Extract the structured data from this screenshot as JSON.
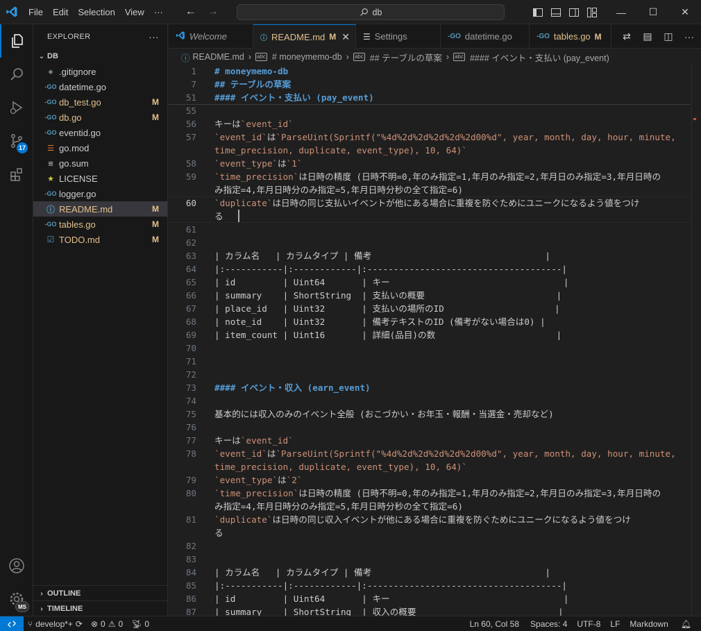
{
  "menu": {
    "file": "File",
    "edit": "Edit",
    "selection": "Selection",
    "view": "View",
    "more": "···"
  },
  "search": {
    "text": "db"
  },
  "activity": {
    "source_control_badge": "17",
    "accounts_badge": "MS"
  },
  "sidebar": {
    "title": "EXPLORER",
    "more": "···",
    "folder": "DB",
    "files": [
      {
        "name": ".gitignore",
        "icon": "gitignore-icon",
        "mod": ""
      },
      {
        "name": "datetime.go",
        "icon": "go-file-icon",
        "mod": ""
      },
      {
        "name": "db_test.go",
        "icon": "go-file-icon",
        "mod": "M"
      },
      {
        "name": "db.go",
        "icon": "go-file-icon",
        "mod": "M"
      },
      {
        "name": "eventid.go",
        "icon": "go-file-icon",
        "mod": ""
      },
      {
        "name": "go.mod",
        "icon": "go-mod-icon",
        "mod": ""
      },
      {
        "name": "go.sum",
        "icon": "go-sum-icon",
        "mod": ""
      },
      {
        "name": "LICENSE",
        "icon": "license-icon",
        "mod": ""
      },
      {
        "name": "logger.go",
        "icon": "go-file-icon",
        "mod": ""
      },
      {
        "name": "README.md",
        "icon": "info-icon",
        "mod": "M"
      },
      {
        "name": "tables.go",
        "icon": "go-file-icon",
        "mod": "M"
      },
      {
        "name": "TODO.md",
        "icon": "todo-icon",
        "mod": "M"
      }
    ],
    "outline": "OUTLINE",
    "timeline": "TIMELINE"
  },
  "tabs": [
    {
      "label": "Welcome",
      "mod": ""
    },
    {
      "label": "README.md",
      "mod": "M"
    },
    {
      "label": "Settings",
      "mod": ""
    },
    {
      "label": "datetime.go",
      "mod": ""
    },
    {
      "label": "tables.go",
      "mod": "M"
    }
  ],
  "breadcrumb": {
    "file": "README.md",
    "h1": "# moneymemo-db",
    "h2": "## テーブルの草案",
    "h4": "#### イベント・支払い (pay_event)"
  },
  "editor": {
    "sticky": [
      {
        "n": "1",
        "t": "# moneymemo-db"
      },
      {
        "n": "7",
        "t": "## テーブルの草案"
      },
      {
        "n": "51",
        "t": "#### イベント・支払い (pay_event)"
      }
    ],
    "lines": [
      {
        "n": "55",
        "t": ""
      },
      {
        "n": "56",
        "t": "キーは`event_id`"
      },
      {
        "n": "57",
        "t": "`event_id`は`ParseUint(Sprintf(\"%4d%2d%2d%2d%2d%2d00%d\", year, month, day, hour, minute,"
      },
      {
        "n": "",
        "t": "time_precision, duplicate, event_type), 10, 64)`"
      },
      {
        "n": "58",
        "t": "`event_type`は`1`"
      },
      {
        "n": "59",
        "t": "`time_precision`は日時の精度 (日時不明=0,年のみ指定=1,年月のみ指定=2,年月日のみ指定=3,年月日時の"
      },
      {
        "n": "",
        "t": "み指定=4,年月日時分のみ指定=5,年月日時分秒の全て指定=6)"
      },
      {
        "n": "60",
        "t": "`duplicate`は日時の同じ支払いイベントが他にある場合に重複を防ぐためにユニークになるよう値をつけ"
      },
      {
        "n": "",
        "t": "る"
      },
      {
        "n": "61",
        "t": ""
      },
      {
        "n": "62",
        "t": ""
      },
      {
        "n": "63",
        "t": "| カラム名   | カラムタイプ | 備考                                 |"
      },
      {
        "n": "64",
        "t": "|:-----------|:------------|:-------------------------------------|"
      },
      {
        "n": "65",
        "t": "| id         | Uint64       | キー                                 |"
      },
      {
        "n": "66",
        "t": "| summary    | ShortString  | 支払いの概要                         |"
      },
      {
        "n": "67",
        "t": "| place_id   | Uint32       | 支払いの場所のID                     |"
      },
      {
        "n": "68",
        "t": "| note_id    | Uint32       | 備考テキストのID (備考がない場合は0) |"
      },
      {
        "n": "69",
        "t": "| item_count | Uint16       | 詳細(品目)の数                       |"
      },
      {
        "n": "70",
        "t": ""
      },
      {
        "n": "71",
        "t": ""
      },
      {
        "n": "72",
        "t": ""
      },
      {
        "n": "73",
        "t": "#### イベント・収入 (earn_event)"
      },
      {
        "n": "74",
        "t": ""
      },
      {
        "n": "75",
        "t": "基本的には収入のみのイベント全般 (おこづかい・お年玉・報酬・当選金・売却など)"
      },
      {
        "n": "76",
        "t": ""
      },
      {
        "n": "77",
        "t": "キーは`event_id`"
      },
      {
        "n": "78",
        "t": "`event_id`は`ParseUint(Sprintf(\"%4d%2d%2d%2d%2d%2d00%d\", year, month, day, hour, minute,"
      },
      {
        "n": "",
        "t": "time_precision, duplicate, event_type), 10, 64)`"
      },
      {
        "n": "79",
        "t": "`event_type`は`2`"
      },
      {
        "n": "80",
        "t": "`time_precision`は日時の精度 (日時不明=0,年のみ指定=1,年月のみ指定=2,年月日のみ指定=3,年月日時の"
      },
      {
        "n": "",
        "t": "み指定=4,年月日時分のみ指定=5,年月日時分秒の全て指定=6)"
      },
      {
        "n": "81",
        "t": "`duplicate`は日時の同じ収入イベントが他にある場合に重複を防ぐためにユニークになるよう値をつけ"
      },
      {
        "n": "",
        "t": "る"
      },
      {
        "n": "82",
        "t": ""
      },
      {
        "n": "83",
        "t": ""
      },
      {
        "n": "84",
        "t": "| カラム名   | カラムタイプ | 備考                                 |"
      },
      {
        "n": "85",
        "t": "|:-----------|:------------|:-------------------------------------|"
      },
      {
        "n": "86",
        "t": "| id         | Uint64       | キー                                 |"
      },
      {
        "n": "87",
        "t": "| summary    | ShortString  | 収入の概要                           |"
      }
    ]
  },
  "status": {
    "branch": "develop*+",
    "errors": "0",
    "warnings": "0",
    "ports": "0",
    "position": "Ln 60, Col 58",
    "spaces": "Spaces: 4",
    "encoding": "UTF-8",
    "eol": "LF",
    "language": "Markdown"
  },
  "colors": {
    "accent": "#0078d4",
    "modified": "#e2c08d",
    "heading": "#569cd6",
    "inline_code": "#ce9178",
    "go_icon": "#519aba",
    "rss_icon": "#e37933",
    "license_icon": "#cbcb41"
  }
}
